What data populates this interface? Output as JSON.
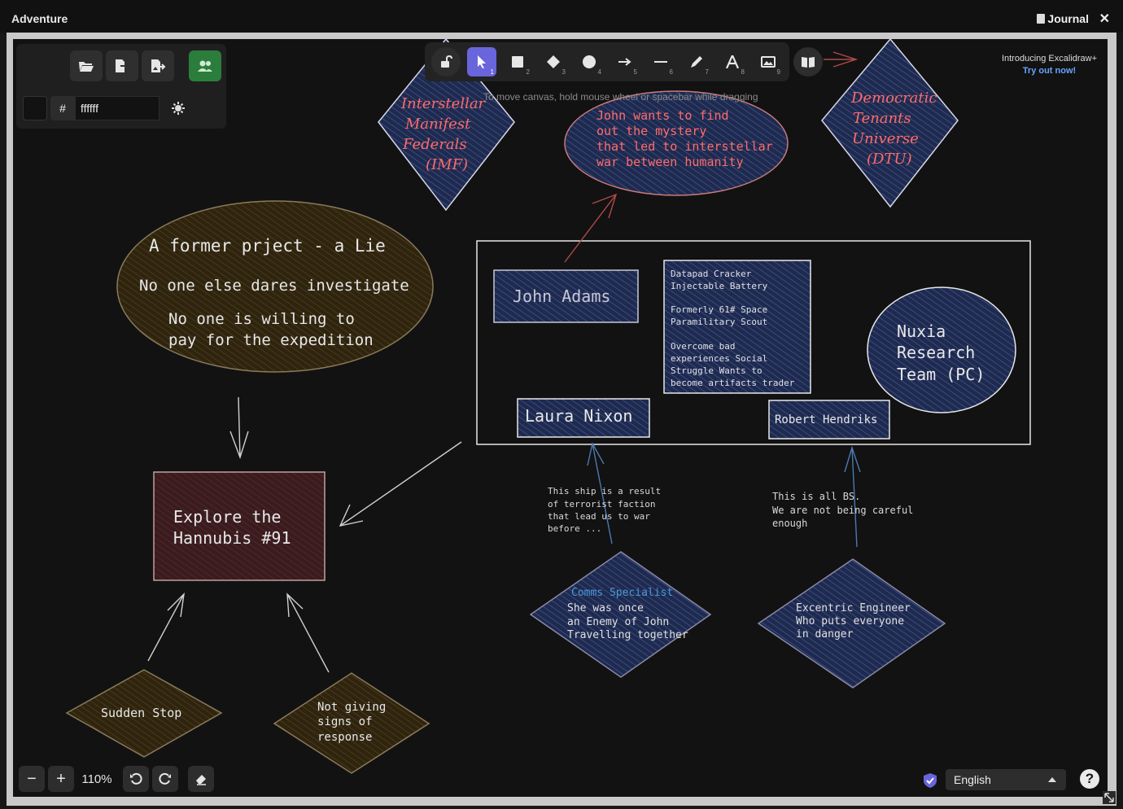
{
  "window": {
    "title": "Adventure",
    "journal_label": "Journal",
    "close_glyph": "✕"
  },
  "panel": {
    "hex_value": "ffffff",
    "hash": "#"
  },
  "toolbar": {
    "keys": [
      "1",
      "2",
      "3",
      "4",
      "5",
      "6",
      "7",
      "8",
      "9"
    ],
    "hint": "To move canvas, hold mouse wheel or spacebar while dragging"
  },
  "promo": {
    "line1": "Introducing Excalidraw+",
    "line2": "Try out now!"
  },
  "footer": {
    "zoom": "110%",
    "language": "English",
    "help": "?"
  },
  "canvas": {
    "lie_title": "A former prject - a Lie",
    "lie_line1": "No one else dares investigate",
    "lie_line2a": "No one is willing to",
    "lie_line2b": "pay for the expedition",
    "imf": [
      "Interstellar",
      "Manifest",
      "Federals",
      "(IMF)"
    ],
    "dtu": [
      "Democratic",
      "Tenants",
      "Universe",
      "(DTU)"
    ],
    "john_goal": [
      "John wants to find",
      "out the mystery",
      "that led to interstellar",
      "war between humanity"
    ],
    "john": "John Adams",
    "datapad": [
      "Datapad Cracker",
      "Injectable Battery",
      "",
      "Formerly 61# Space",
      "Paramilitary Scout",
      "",
      "Overcome bad",
      "experiences Social",
      "Struggle Wants to",
      "become artifacts trader"
    ],
    "nuxia": [
      "Nuxia",
      "Research",
      "Team (PC)"
    ],
    "laura": "Laura Nixon",
    "robert": "Robert Hendriks",
    "explore": [
      "Explore the",
      "Hannubis #91"
    ],
    "ship_note": [
      "This ship is a result",
      "of terrorist faction",
      "that lead us to war",
      "before ..."
    ],
    "bs_note": [
      "This is all BS.",
      "We are not being careful",
      "enough"
    ],
    "comms_title": "Comms Specialist",
    "comms": [
      "She was once",
      "an Enemy of John",
      "Travelling together"
    ],
    "engineer": [
      "Excentric Engineer",
      "Who puts everyone",
      "in danger"
    ],
    "sudden": "Sudden Stop",
    "notgiving": [
      "Not giving",
      "signs of",
      "response"
    ]
  }
}
